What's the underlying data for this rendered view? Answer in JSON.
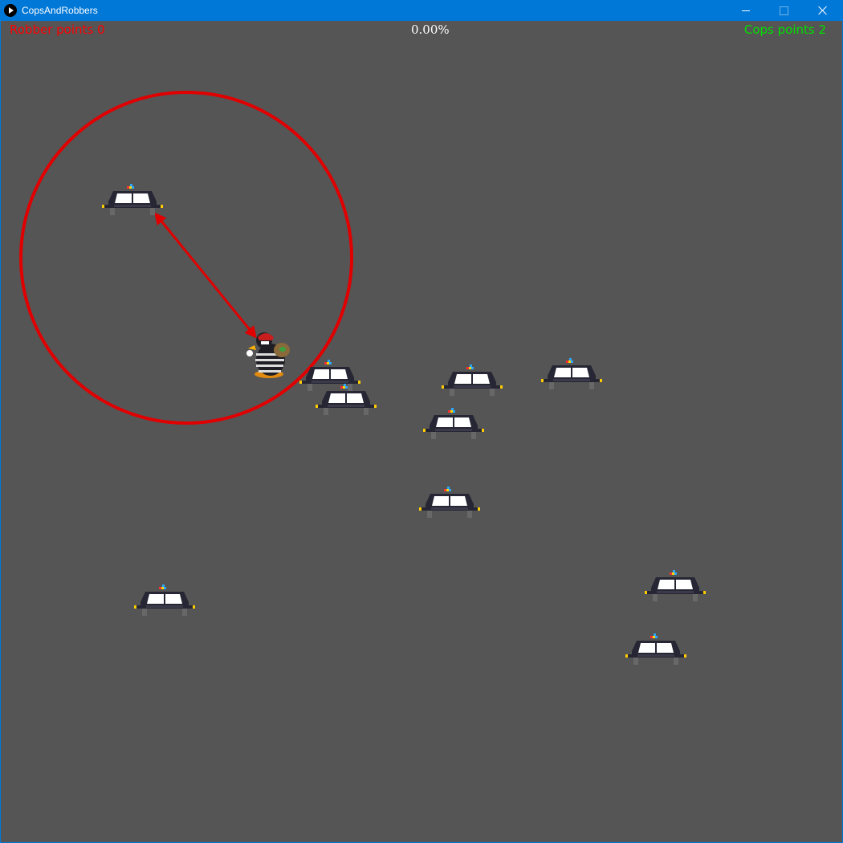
{
  "window": {
    "title": "CopsAndRobbers",
    "icon": "play-icon"
  },
  "hud": {
    "robber_points": "Robber points 0",
    "progress": "0.00%",
    "cops_points": "Cops points 2"
  },
  "colors": {
    "titlebar": "#0078d7",
    "background": "#555555",
    "robber_text": "#ff0000",
    "cops_text": "#00e000",
    "radius": "#e00000"
  },
  "sprites": {
    "robber": "penguin-robber-icon",
    "cop": "police-car-icon"
  }
}
